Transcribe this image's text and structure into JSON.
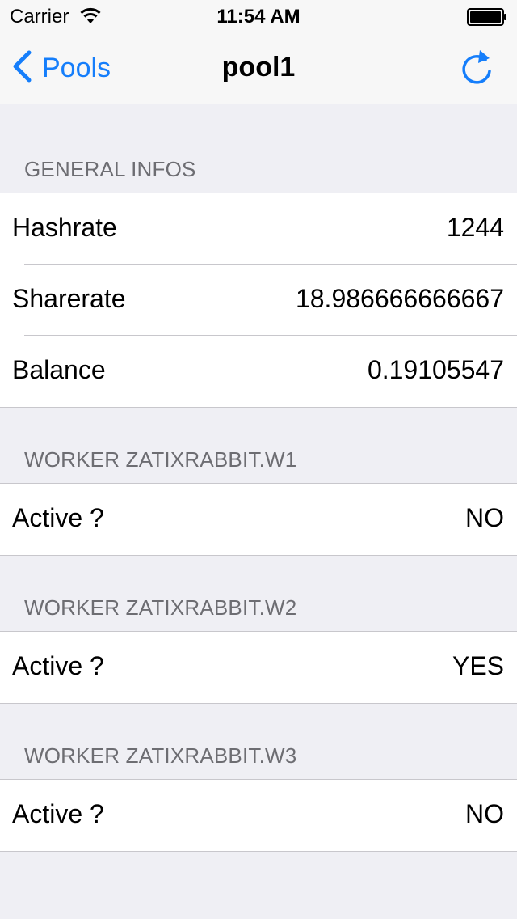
{
  "status_bar": {
    "carrier": "Carrier",
    "time": "11:54 AM"
  },
  "nav": {
    "back_label": "Pools",
    "title": "pool1",
    "accent_color": "#157efb",
    "refresh_icon": "refresh-icon"
  },
  "sections": [
    {
      "header": "GENERAL INFOS",
      "rows": [
        {
          "label": "Hashrate",
          "value": "1244"
        },
        {
          "label": "Sharerate",
          "value": "18.986666666667"
        },
        {
          "label": "Balance",
          "value": "0.19105547"
        }
      ]
    },
    {
      "header": "WORKER ZATIXRABBIT.W1",
      "rows": [
        {
          "label": "Active ?",
          "value": "NO"
        }
      ]
    },
    {
      "header": "WORKER ZATIXRABBIT.W2",
      "rows": [
        {
          "label": "Active ?",
          "value": "YES"
        }
      ]
    },
    {
      "header": "WORKER ZATIXRABBIT.W3",
      "rows": [
        {
          "label": "Active ?",
          "value": "NO"
        }
      ]
    }
  ]
}
